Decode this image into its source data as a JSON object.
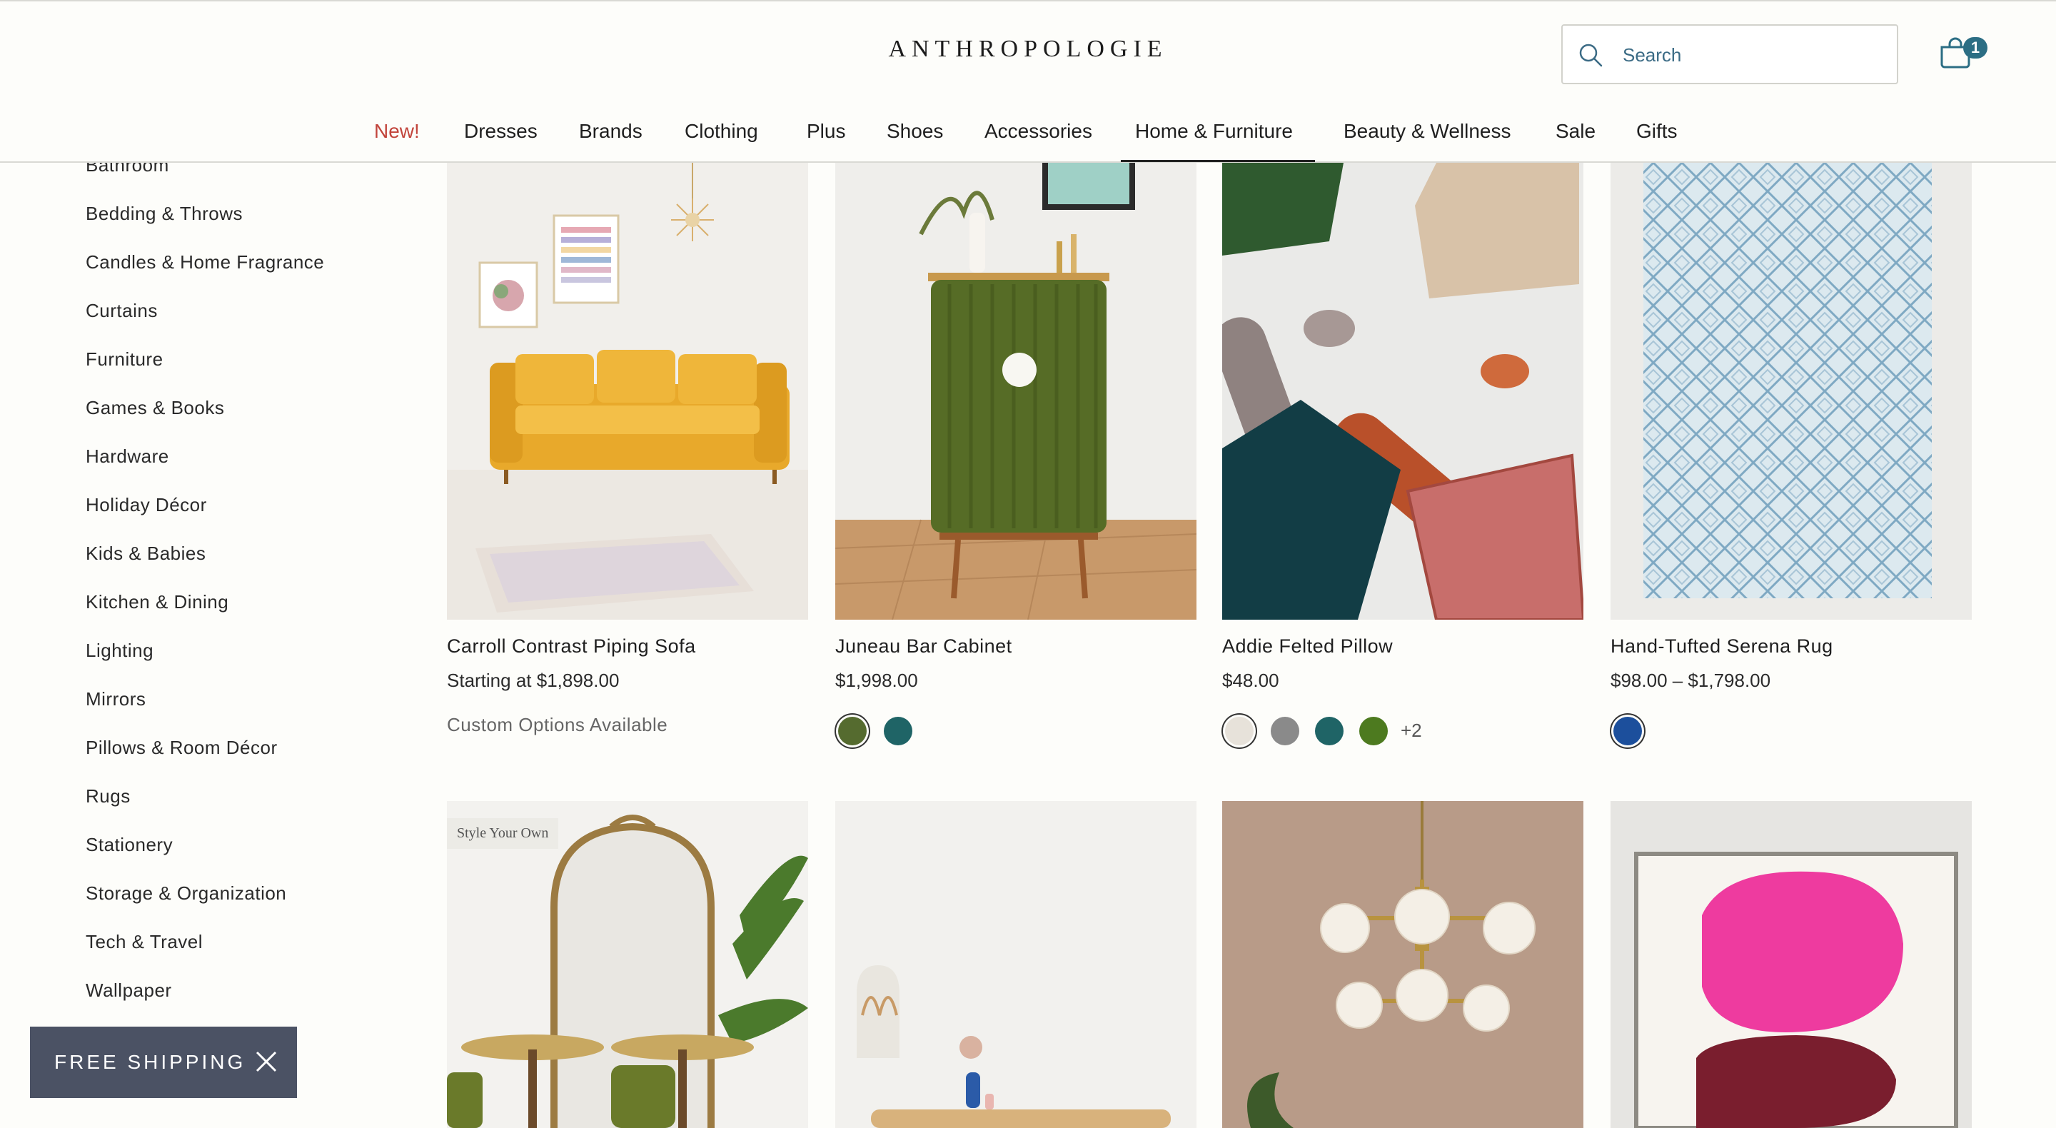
{
  "header": {
    "logo": "ANTHROPOLOGIE",
    "search_placeholder": "Search",
    "cart_count": "1",
    "accent_color": "#2c6e84"
  },
  "nav": {
    "items": [
      {
        "label": "New!"
      },
      {
        "label": "Dresses"
      },
      {
        "label": "Brands"
      },
      {
        "label": "Clothing"
      },
      {
        "label": "Plus"
      },
      {
        "label": "Shoes"
      },
      {
        "label": "Accessories"
      },
      {
        "label": "Home & Furniture"
      },
      {
        "label": "Beauty & Wellness"
      },
      {
        "label": "Sale"
      },
      {
        "label": "Gifts"
      }
    ],
    "active": "Home & Furniture"
  },
  "sidebar": {
    "items": [
      {
        "label": "Bathroom"
      },
      {
        "label": "Bedding & Throws"
      },
      {
        "label": "Candles & Home Fragrance"
      },
      {
        "label": "Curtains"
      },
      {
        "label": "Furniture"
      },
      {
        "label": "Games & Books"
      },
      {
        "label": "Hardware"
      },
      {
        "label": "Holiday Décor"
      },
      {
        "label": "Kids & Babies"
      },
      {
        "label": "Kitchen & Dining"
      },
      {
        "label": "Lighting"
      },
      {
        "label": "Mirrors"
      },
      {
        "label": "Pillows & Room Décor"
      },
      {
        "label": "Rugs"
      },
      {
        "label": "Stationery"
      },
      {
        "label": "Storage & Organization"
      },
      {
        "label": "Tech & Travel"
      },
      {
        "label": "Wallpaper"
      }
    ]
  },
  "products": [
    {
      "name": "Carroll Contrast Piping Sofa",
      "price": "Starting at $1,898.00",
      "note": "Custom Options Available",
      "swatches": [],
      "more": ""
    },
    {
      "name": "Juneau Bar Cabinet",
      "price": "$1,998.00",
      "note": "",
      "swatches": [
        "#556b2f",
        "#1f6466"
      ],
      "more": ""
    },
    {
      "name": "Addie Felted Pillow",
      "price": "$48.00",
      "note": "",
      "swatches": [
        "#e7e2da",
        "#8a8a8a",
        "#1f6466",
        "#4d7a1f"
      ],
      "more": "+2"
    },
    {
      "name": "Hand-Tufted Serena Rug",
      "price": "$98.00 – $1,798.00",
      "note": "",
      "swatches": [
        "#1c4f9c"
      ],
      "more": ""
    }
  ],
  "row2": {
    "tag": "Style Your Own"
  },
  "free_shipping": {
    "label": "FREE SHIPPING"
  }
}
